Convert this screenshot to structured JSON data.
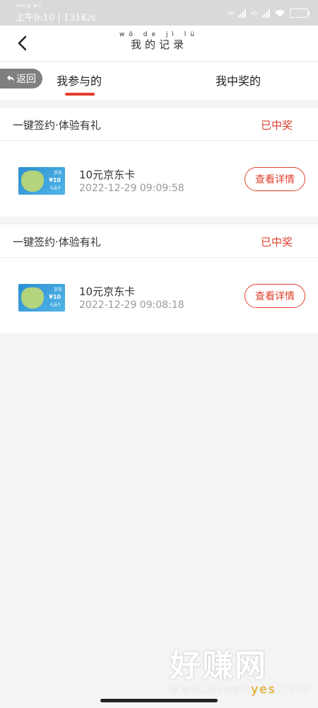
{
  "status_bar": {
    "pinyin": "dàng wǔ",
    "time": "上午9:10 | 131K/s",
    "net1": "HD",
    "net2": "HD"
  },
  "header": {
    "title_pinyin": "wǒ de jì lù",
    "title": "我的记录"
  },
  "tabs": {
    "back_label": "返回",
    "tab1": "我参与的",
    "tab2": "我中奖的"
  },
  "records": [
    {
      "activity": "一键签约·体验有礼",
      "status": "已中奖",
      "prize_name": "10元京东卡",
      "time": "2022-12-29 09:09:58",
      "button": "查看详情",
      "card_value": "¥10",
      "card_sub": "礼品卡",
      "card_logo": "京东"
    },
    {
      "activity": "一键签约·体验有礼",
      "status": "已中奖",
      "prize_name": "10元京东卡",
      "time": "2022-12-29 09:08:18",
      "button": "查看详情",
      "card_value": "¥10",
      "card_sub": "礼品卡",
      "card_logo": "京东"
    }
  ],
  "watermark": {
    "big": "好赚网",
    "url_a": "www.zhuan",
    "url_b": "yes",
    "url_c": ".com"
  },
  "colors": {
    "accent": "#e0402e",
    "tab_underline": "#e53b2e"
  }
}
